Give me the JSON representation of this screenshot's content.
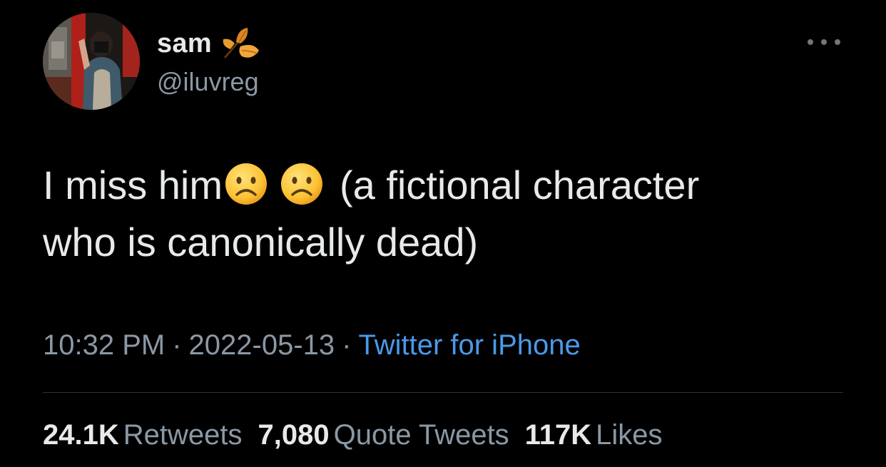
{
  "author": {
    "display_name": "sam",
    "handle": "@iluvreg",
    "name_icon": "autumn-leaves-icon",
    "avatar": "profile-photo"
  },
  "tweet": {
    "text_line1_start": "I miss him",
    "emoji_1": "frowning-face-icon",
    "emoji_2": "frowning-face-icon",
    "text_line1_end": "(a fictional character",
    "text_line2": "who is canonically dead)"
  },
  "meta": {
    "time": "10:32 PM",
    "separator": "·",
    "date": "2022-05-13",
    "source": "Twitter for iPhone"
  },
  "stats": {
    "retweets_count": "24.1K",
    "retweets_label": "Retweets",
    "quotes_count": "7,080",
    "quotes_label": "Quote Tweets",
    "likes_count": "117K",
    "likes_label": "Likes"
  },
  "more_icon": "more-options-icon",
  "colors": {
    "background": "#000000",
    "primary_text": "#e7e9ea",
    "secondary_text": "#8b98a5",
    "link": "#4a99e9",
    "divider": "#2f3336"
  }
}
